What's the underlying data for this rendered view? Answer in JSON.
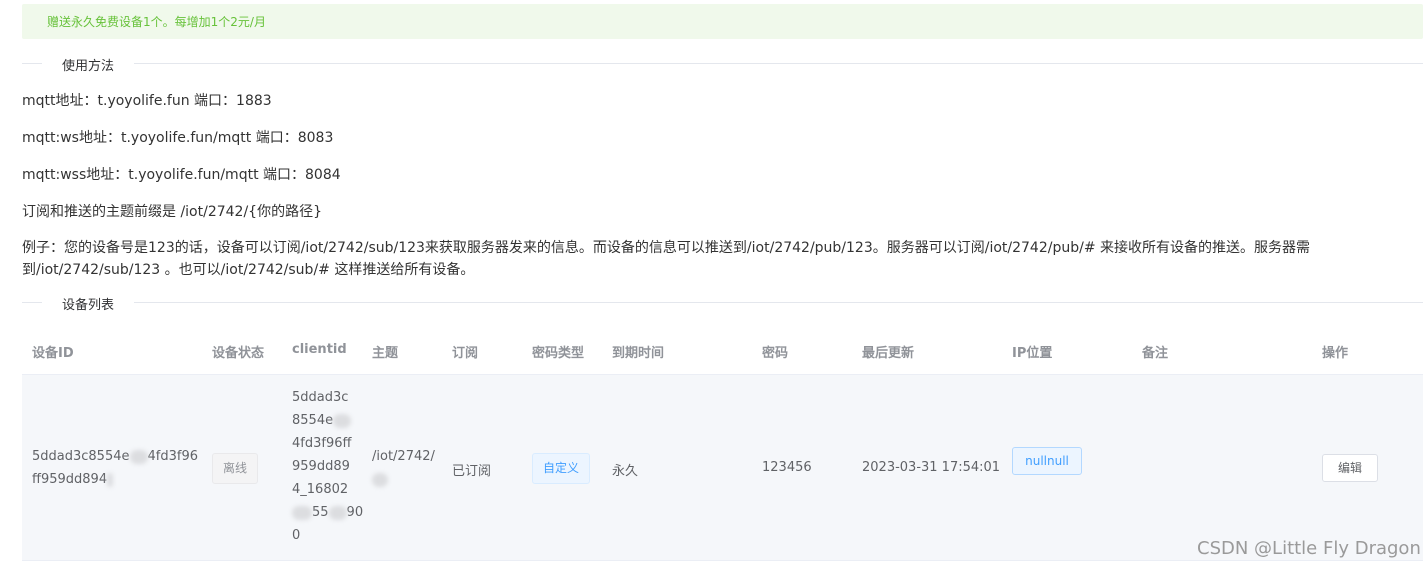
{
  "notice": "赠送永久免费设备1个。每增加1个2元/月",
  "usage_section": "使用方法",
  "usage_lines": [
    "mqtt地址：t.yoyolife.fun 端口：1883",
    "mqtt:ws地址：t.yoyolife.fun/mqtt 端口：8083",
    "mqtt:wss地址：t.yoyolife.fun/mqtt 端口：8084",
    "订阅和推送的主题前缀是 /iot/2742/{你的路径}"
  ],
  "example_line1": "例子：您的设备号是123的话，设备可以订阅/iot/2742/sub/123来获取服务器发来的信息。而设备的信息可以推送到/iot/2742/pub/123。服务器可以订阅/iot/2742/pub/# 来接收所有设备的推送。服务器需",
  "example_line2": "到/iot/2742/sub/123 。也可以/iot/2742/sub/# 这样推送给所有设备。",
  "device_section": "设备列表",
  "table": {
    "headers": [
      "设备ID",
      "设备状态",
      "clientid",
      "主题",
      "订阅",
      "密码类型",
      "到期时间",
      "密码",
      "最后更新",
      "IP位置",
      "备注",
      "操作"
    ],
    "row": {
      "device_id_1": "5ddad3c8554e",
      "device_id_1b": "4fd3f96",
      "device_id_2": "ff959dd894",
      "status": "离线",
      "clientid_lines": [
        "5ddad3c",
        "8554e",
        "4fd3f96ff",
        "959dd89",
        "4_16802",
        "55",
        "90",
        "0"
      ],
      "topic": "/iot/2742/",
      "subscribed": "已订阅",
      "password_type": "自定义",
      "expiry": "永久",
      "password": "123456",
      "last_update": "2023-03-31 17:54:01",
      "ip": "nullnull",
      "remark": "",
      "edit_label": "编辑"
    }
  },
  "watermark": "CSDN @Little Fly Dragon"
}
